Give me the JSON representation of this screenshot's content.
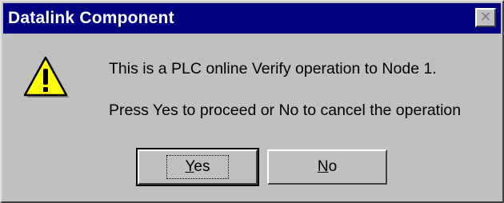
{
  "window": {
    "title": "Datalink Component",
    "close_glyph": "✕"
  },
  "message": {
    "icon": "warning-icon",
    "line1": "This is a PLC online Verify operation to Node 1.",
    "line2": "Press Yes to proceed or No to cancel the operation"
  },
  "buttons": {
    "yes": {
      "mnemonic": "Y",
      "rest": "es"
    },
    "no": {
      "mnemonic": "N",
      "rest": "o"
    }
  },
  "colors": {
    "titlebar": "#000080",
    "face": "#c0c0c0",
    "warning_fill": "#ffff00"
  }
}
